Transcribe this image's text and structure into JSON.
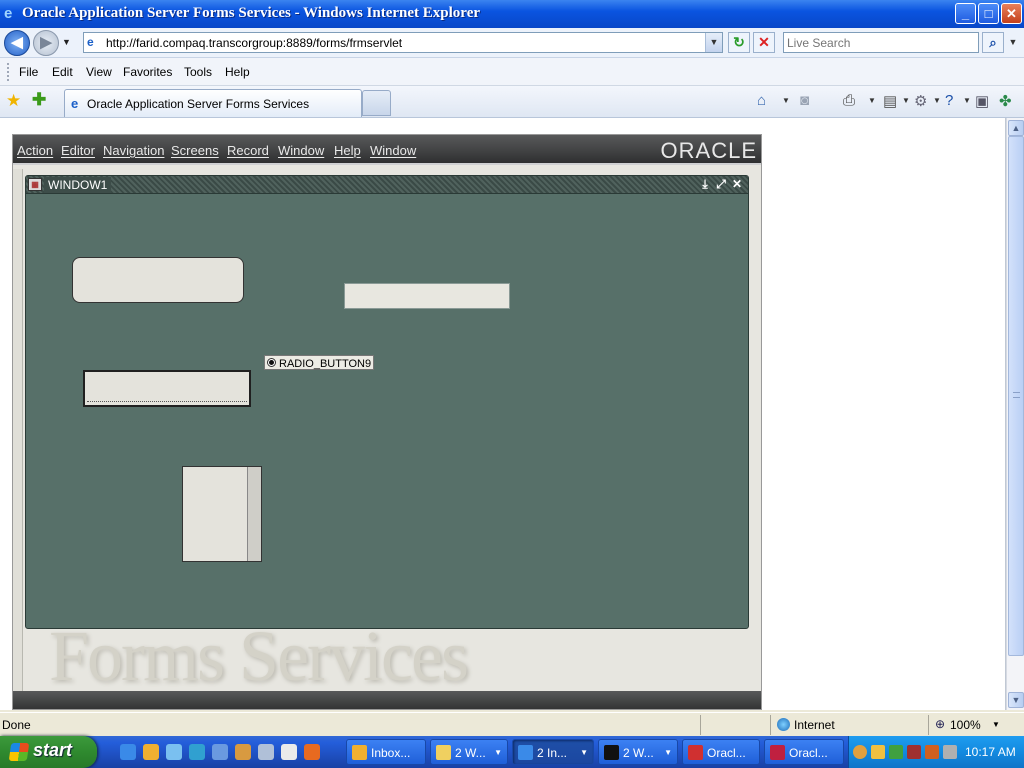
{
  "window": {
    "title": "Oracle Application Server Forms Services - Windows Internet Explorer",
    "min": "_",
    "max": "□",
    "close": "✕"
  },
  "addressbar": {
    "url": "http://farid.compaq.transcorgroup:8889/forms/frmservlet",
    "search_placeholder": "Live Search",
    "back": "◀",
    "forward": "▶"
  },
  "menu": {
    "items": [
      "File",
      "Edit",
      "View",
      "Favorites",
      "Tools",
      "Help"
    ]
  },
  "tabs": {
    "active": "Oracle Application Server Forms Services"
  },
  "forms": {
    "menu": [
      "Action",
      "Editor",
      "Navigation",
      "Screens",
      "Record",
      "Window",
      "Help",
      "Window"
    ],
    "logo": "ORACLE",
    "watermark": "Forms Services",
    "window_title": "WINDOW1",
    "radio_label": "RADIO_BUTTON9"
  },
  "status": {
    "text": "Done",
    "zone": "Internet",
    "zoom": "100%"
  },
  "taskbar": {
    "start": "start",
    "buttons": [
      "Inbox...",
      "2 W...",
      "2 In...",
      "2 W...",
      "Oracl...",
      "Oracl..."
    ],
    "clock": "10:17 AM"
  },
  "colors": {
    "forms_canvas": "#577069",
    "xp_blue": "#0a54e0",
    "start_green": "#2f8a2f"
  }
}
